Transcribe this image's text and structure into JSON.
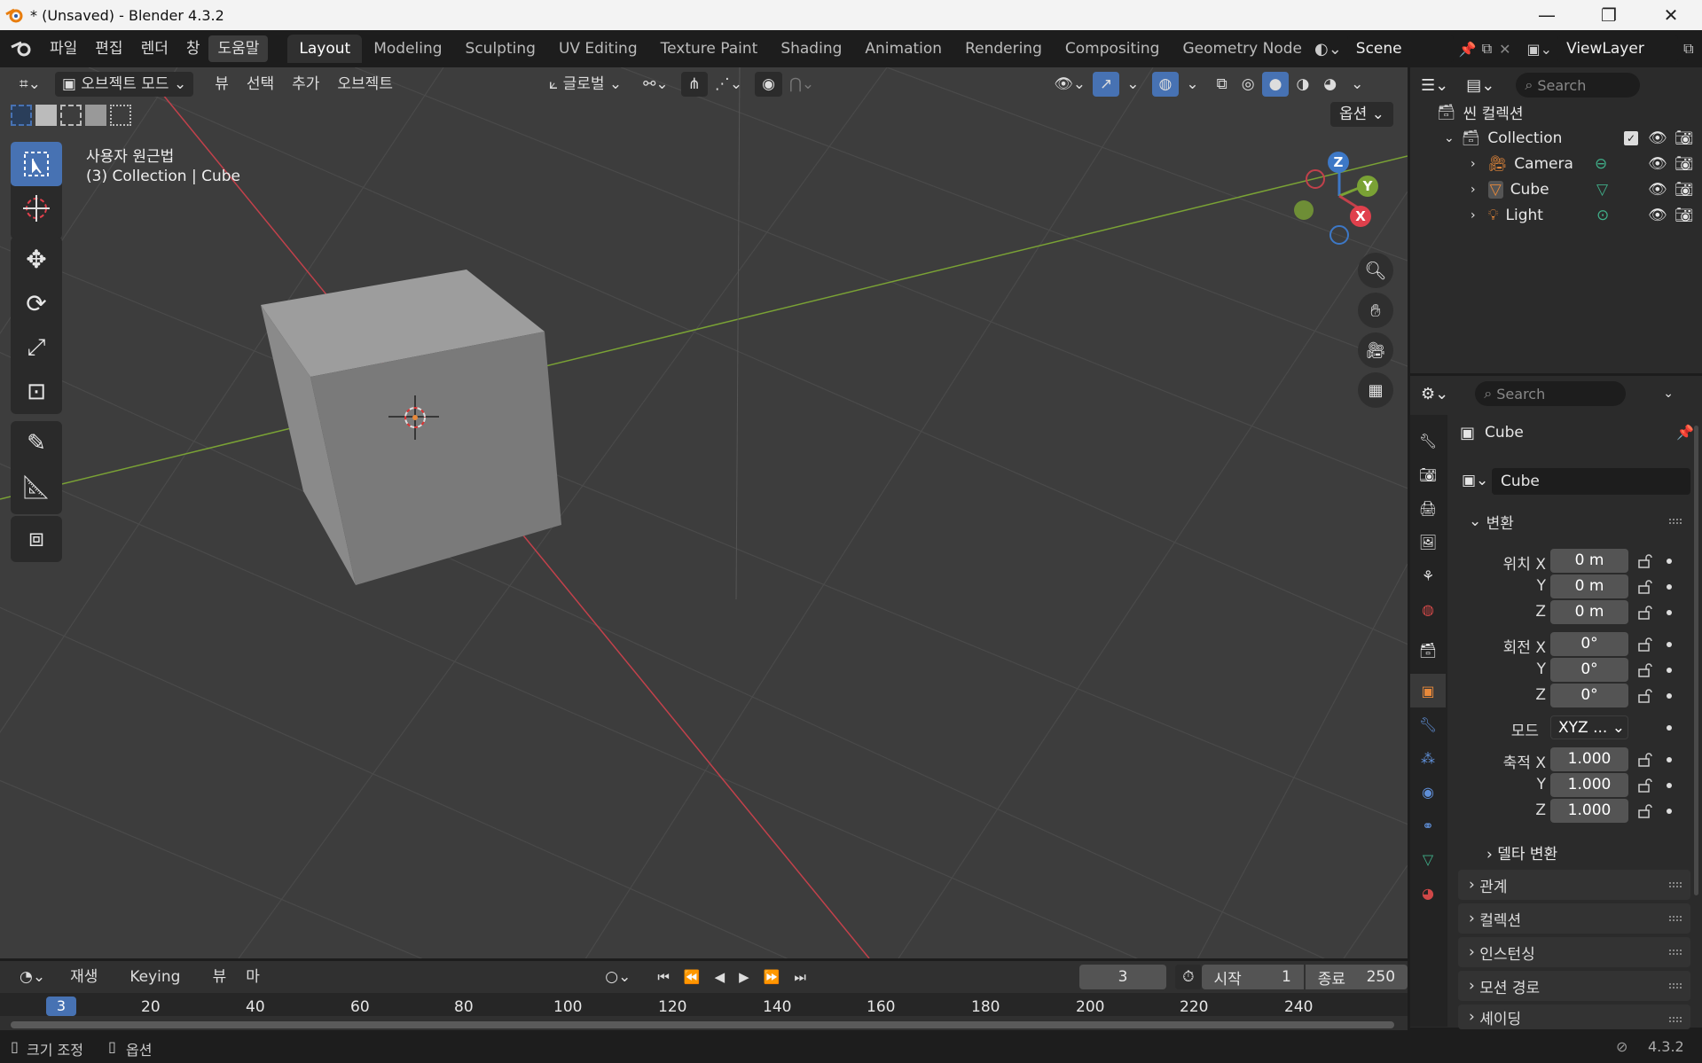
{
  "titlebar": {
    "title": "* (Unsaved) - Blender 4.3.2"
  },
  "menubar": {
    "items": [
      "파일",
      "편집",
      "렌더",
      "창",
      "도움말"
    ],
    "workspaces": [
      "Layout",
      "Modeling",
      "Sculpting",
      "UV Editing",
      "Texture Paint",
      "Shading",
      "Animation",
      "Rendering",
      "Compositing",
      "Geometry Node"
    ],
    "scene": "Scene",
    "view_layer": "ViewLayer"
  },
  "viewport_header": {
    "mode": "오브젝트 모드",
    "menus": [
      "뷰",
      "선택",
      "추가",
      "오브젝트"
    ],
    "transform_orientation": "글로벌",
    "options": "옵션"
  },
  "viewport": {
    "view_name": "사용자 원근법",
    "context": "(3) Collection | Cube",
    "gizmo": {
      "x": "X",
      "y": "Y",
      "z": "Z"
    }
  },
  "outliner": {
    "search_placeholder": "Search",
    "scene_collection": "씬 컬렉션",
    "collection": "Collection",
    "objects": [
      "Camera",
      "Cube",
      "Light"
    ]
  },
  "properties": {
    "search_placeholder": "Search",
    "object_name": "Cube",
    "object_field": "Cube",
    "transform": {
      "title": "변환",
      "location_label": "위치",
      "rotation_label": "회전",
      "mode_label": "모드",
      "scale_label": "축적",
      "axes": [
        "X",
        "Y",
        "Z"
      ],
      "location": [
        "0 m",
        "0 m",
        "0 m"
      ],
      "rotation": [
        "0°",
        "0°",
        "0°"
      ],
      "mode": "XYZ ...",
      "scale": [
        "1.000",
        "1.000",
        "1.000"
      ],
      "delta": "델타 변환"
    },
    "panels": [
      "관계",
      "컬렉션",
      "인스턴싱",
      "모션 경로",
      "셰이딩"
    ]
  },
  "timeline": {
    "menus": [
      "재생",
      "Keying",
      "뷰",
      "마커"
    ],
    "current_frame": "3",
    "start_label": "시작",
    "start": "1",
    "end_label": "종료",
    "end": "250",
    "ticks": [
      "20",
      "40",
      "60",
      "80",
      "100",
      "120",
      "140",
      "160",
      "180",
      "200",
      "220",
      "240"
    ]
  },
  "statusbar": {
    "left1": "크기 조정",
    "left2": "옵션",
    "version": "4.3.2"
  },
  "colors": {
    "accent": "#4772b3",
    "x_axis": "#c2414b",
    "y_axis": "#7aa235",
    "z_axis": "#3d78c6",
    "object_orange": "#e8893a"
  }
}
